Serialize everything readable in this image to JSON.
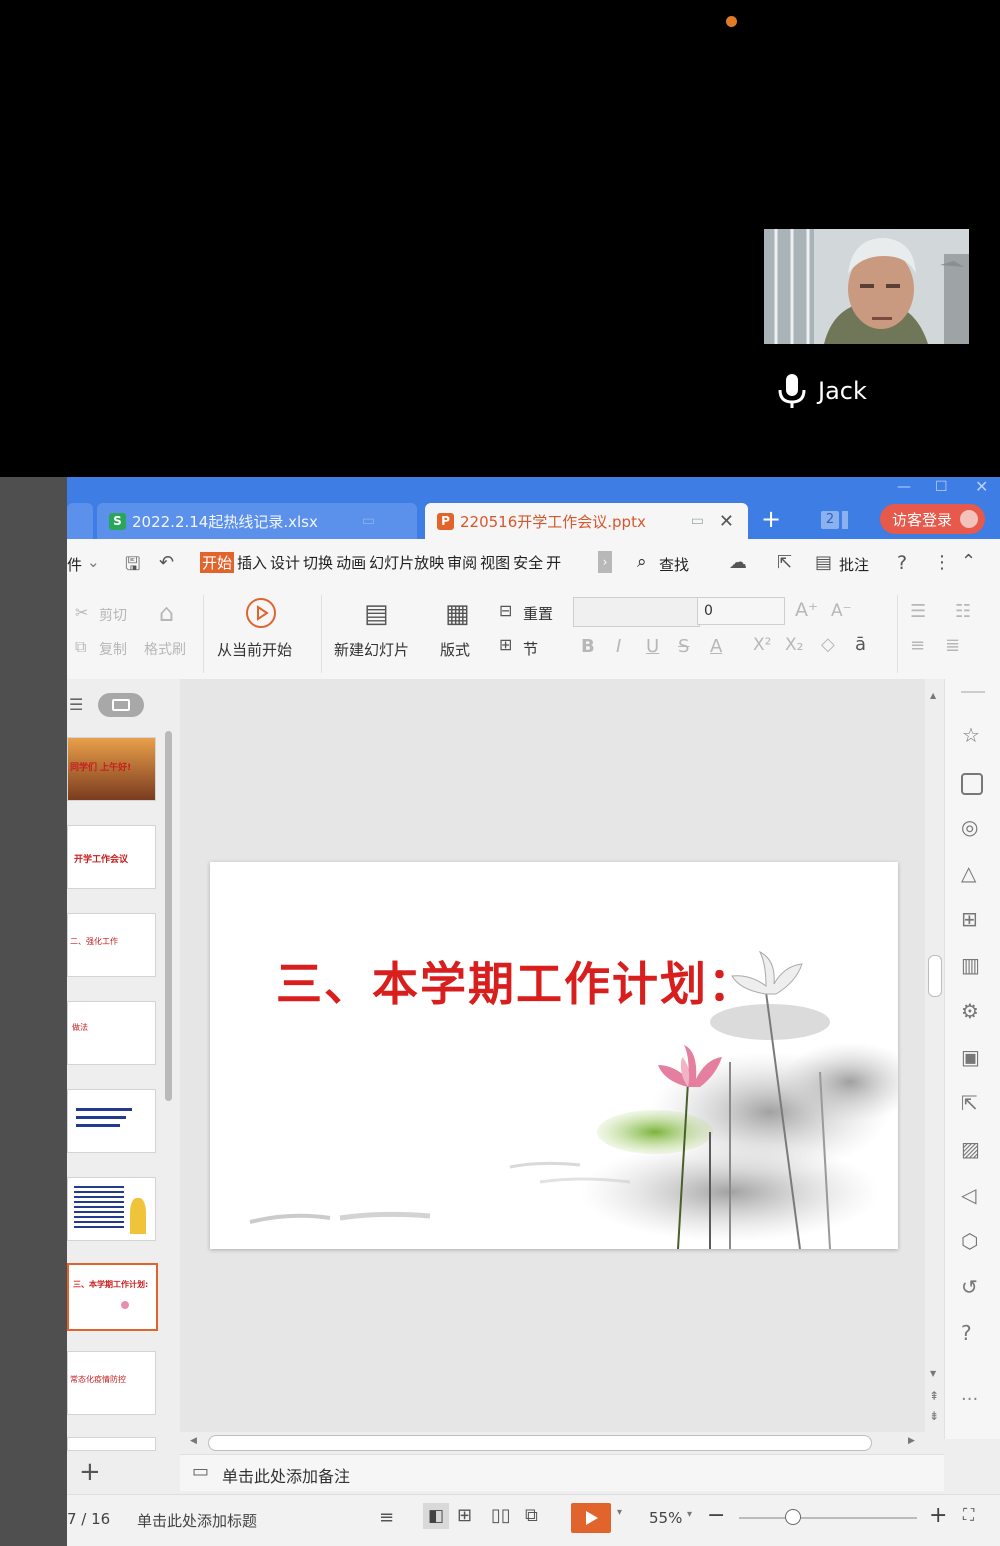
{
  "call": {
    "participant_name": "Jack",
    "recording_dot_color": "#e07b28"
  },
  "tabs": {
    "xlsx_title": "2022.2.14起热线记录.xlsx",
    "pptx_title": "220516开学工作会议.pptx",
    "xlsx_badge": "S",
    "pptx_badge": "P",
    "new_tab": "+",
    "window_count": "2",
    "guest_login": "访客登录"
  },
  "menu": {
    "file_fragment": "件",
    "items": [
      "开始",
      "插入",
      "设计",
      "切换",
      "动画",
      "幻灯片放映",
      "审阅",
      "视图",
      "安全",
      "开"
    ],
    "active": "开始",
    "search": "查找",
    "comment": "批注",
    "help": "?"
  },
  "ribbon": {
    "cut": "剪切",
    "copy": "复制",
    "format_painter": "格式刷",
    "play_from_current": "从当前开始",
    "new_slide": "新建幻灯片",
    "layout": "版式",
    "reset": "重置",
    "section": "节",
    "font_size_value": "0",
    "bold": "B",
    "italic": "I",
    "underline": "U",
    "strike": "S",
    "font_color": "A"
  },
  "slides": {
    "current_title": "三、本学期工作计划：",
    "thumbs": [
      "同学们 上午好!",
      "开学工作会议",
      "二、强化工作",
      "做法",
      "",
      "",
      "三、本学期工作计划:",
      "常态化疫情防控"
    ],
    "selected_index": 6
  },
  "notes": {
    "placeholder": "单击此处添加备注"
  },
  "status": {
    "page": "7 / 16",
    "add_title": "单击此处添加标题",
    "zoom": "55%",
    "zoom_level": 0.3
  },
  "colors": {
    "tabbar_blue": "#3d7de4",
    "accent_orange": "#d8562c",
    "title_red": "#d91e1e"
  }
}
